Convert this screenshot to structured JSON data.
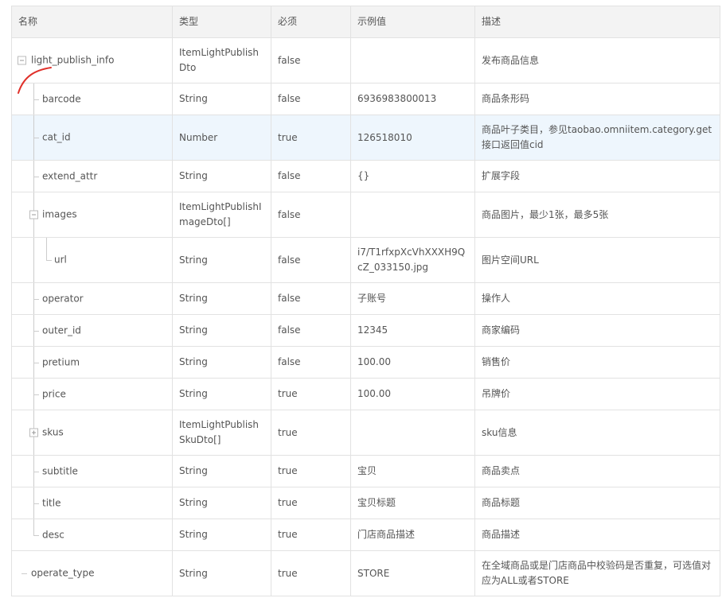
{
  "headers": {
    "name": "名称",
    "type": "类型",
    "required": "必须",
    "example": "示例值",
    "description": "描述"
  },
  "rows": [
    {
      "name": "light_publish_info",
      "type": "ItemLightPublishDto",
      "required": "false",
      "example": "",
      "description": "发布商品信息"
    },
    {
      "name": "barcode",
      "type": "String",
      "required": "false",
      "example": "6936983800013",
      "description": "商品条形码"
    },
    {
      "name": "cat_id",
      "type": "Number",
      "required": "true",
      "example": "126518010",
      "description": "商品叶子类目，参见taobao.omniitem.category.get接口返回值cid"
    },
    {
      "name": "extend_attr",
      "type": "String",
      "required": "false",
      "example": "{}",
      "description": "扩展字段"
    },
    {
      "name": "images",
      "type": "ItemLightPublishImageDto[]",
      "required": "false",
      "example": "",
      "description": "商品图片，最少1张，最多5张"
    },
    {
      "name": "url",
      "type": "String",
      "required": "false",
      "example": "i7/T1rfxpXcVhXXXH9QcZ_033150.jpg",
      "description": "图片空间URL"
    },
    {
      "name": "operator",
      "type": "String",
      "required": "false",
      "example": "子账号",
      "description": "操作人"
    },
    {
      "name": "outer_id",
      "type": "String",
      "required": "false",
      "example": "12345",
      "description": "商家编码"
    },
    {
      "name": "pretium",
      "type": "String",
      "required": "false",
      "example": "100.00",
      "description": "销售价"
    },
    {
      "name": "price",
      "type": "String",
      "required": "true",
      "example": "100.00",
      "description": "吊牌价"
    },
    {
      "name": "skus",
      "type": "ItemLightPublishSkuDto[]",
      "required": "true",
      "example": "",
      "description": "sku信息"
    },
    {
      "name": "subtitle",
      "type": "String",
      "required": "true",
      "example": "宝贝",
      "description": "商品卖点"
    },
    {
      "name": "title",
      "type": "String",
      "required": "true",
      "example": "宝贝标题",
      "description": "商品标题"
    },
    {
      "name": "desc",
      "type": "String",
      "required": "true",
      "example": "门店商品描述",
      "description": "商品描述"
    },
    {
      "name": "operate_type",
      "type": "String",
      "required": "true",
      "example": "STORE",
      "description": "在全域商品或是门店商品中校验码是否重复，可选值对应为ALL或者STORE"
    }
  ],
  "colors": {
    "required_true": "#d81e06",
    "highlight_row": "#eef6fd",
    "header_bg": "#f3f3f3",
    "annotation_stroke": "#e0302a"
  }
}
